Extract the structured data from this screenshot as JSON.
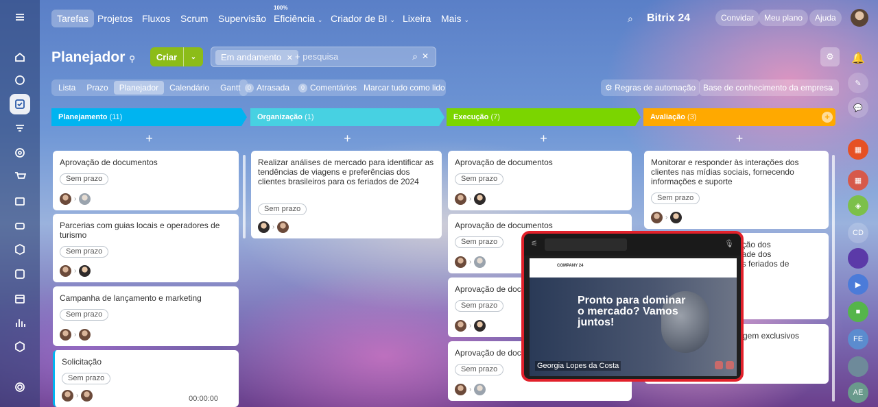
{
  "topnav": {
    "items": [
      "Tarefas",
      "Projetos",
      "Fluxos",
      "Scrum",
      "Supervisão",
      "Eficiência",
      "Criador de BI",
      "Lixeira",
      "Mais"
    ],
    "efficiency_percent": "100%",
    "brand": "Bitrix 24",
    "invite": "Convidar",
    "plan": "Meu plano",
    "help": "Ajuda"
  },
  "page": {
    "title": "Planejador",
    "create_label": "Criar",
    "filter_chip": "Em andamento",
    "search_placeholder": "+ pesquisa"
  },
  "views": [
    "Lista",
    "Prazo",
    "Planejador",
    "Calendário",
    "Gantt"
  ],
  "counters": {
    "overdue_count": "0",
    "overdue_label": "Atrasada",
    "comments_count": "0",
    "comments_label": "Comentários",
    "mark_all": "Marcar tudo como lido"
  },
  "automation_label": "Regras de automação",
  "knowledge_label": "Base de conhecimento da empresa",
  "columns": [
    {
      "name": "Planejamento",
      "count": "(11)",
      "color": "#00b4f0"
    },
    {
      "name": "Organização",
      "count": "(1)",
      "color": "#47d1e2"
    },
    {
      "name": "Execução",
      "count": "(7)",
      "color": "#7bd500"
    },
    {
      "name": "Avaliação",
      "count": "(3)",
      "color": "#ffa900"
    }
  ],
  "cards": {
    "c1": {
      "title": "Aprovação de documentos",
      "deadline": "Sem prazo"
    },
    "c2": {
      "title": "Parcerias com guias locais e operadores de turismo",
      "deadline": "Sem prazo"
    },
    "c3": {
      "title": "Campanha de lançamento e marketing",
      "deadline": "Sem prazo"
    },
    "c4": {
      "title": "Solicitação",
      "deadline": "Sem prazo",
      "timer": "00:00:00"
    },
    "o1": {
      "title": "Realizar análises de mercado para identificar as tendências de viagens e preferências dos clientes brasileiros para os feriados de 2024",
      "deadline": "Sem prazo"
    },
    "e1": {
      "title": "Aprovação de documentos",
      "deadline": "Sem prazo"
    },
    "e2": {
      "title": "Aprovação de documentos",
      "deadline": "Sem prazo"
    },
    "e3": {
      "title": "Aprovação de docum",
      "deadline": "Sem prazo"
    },
    "e4": {
      "title": "Aprovação de docum",
      "deadline": "Sem prazo"
    },
    "a1": {
      "title": "Monitorar e responder às interações dos clientes nas mídias sociais, fornecendo informações e suporte",
      "deadline": "Sem prazo"
    },
    "a2": {
      "title": "ação dos\ndade dos\nos feriados de"
    },
    "a3": {
      "title": "gem exclusivos"
    }
  },
  "popup": {
    "site_name": "COMPANY 24",
    "hero_text": "Pronto para dominar o mercado? Vamos juntos!",
    "participant": "Georgia Lopes da Costa"
  },
  "right_rail": [
    "CD",
    "FE",
    "AE"
  ]
}
